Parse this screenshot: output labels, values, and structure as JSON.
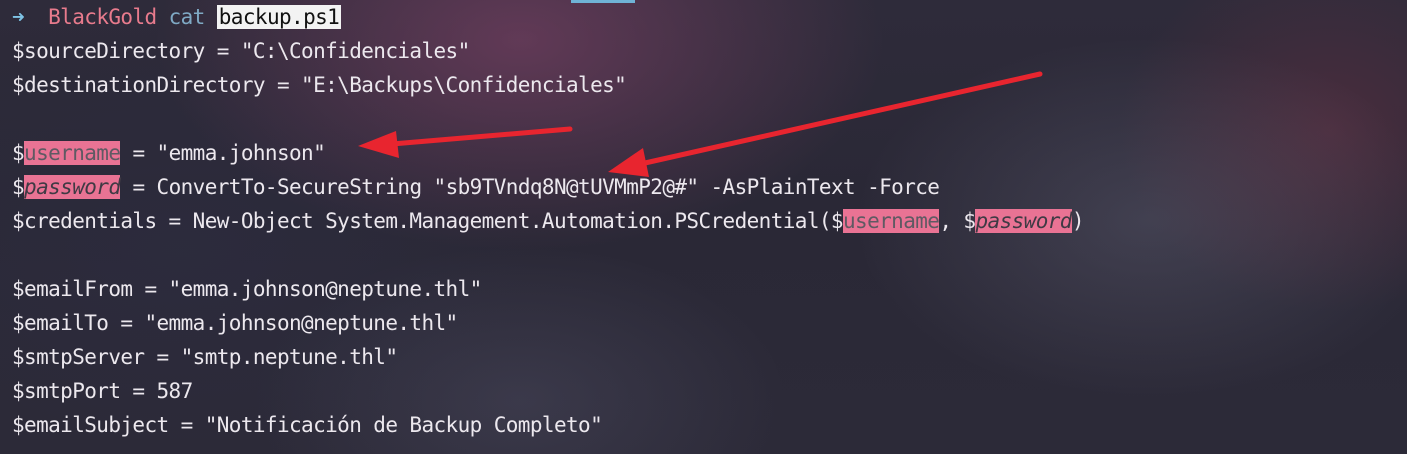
{
  "prompt": {
    "arrow": "➜",
    "host": "BlackGold",
    "command": "cat",
    "argument": "backup.ps1"
  },
  "code": {
    "line_source": "$sourceDirectory = \"C:\\Confidenciales\"",
    "line_destination": "$destinationDirectory = \"E:\\Backups\\Confidenciales\"",
    "username_dollar": "$",
    "username_var": "username",
    "username_rest": " = \"emma.johnson\"",
    "password_dollar": "$",
    "password_var": "password",
    "password_rest": " = ConvertTo-SecureString \"sb9TVndq8N@tUVMmP2@#\" -AsPlainText -Force",
    "cred_prefix": "$credentials = New-Object System.Management.Automation.PSCredential($",
    "cred_username": "username",
    "cred_sep": ", $",
    "cred_password": "password",
    "cred_suffix": ")",
    "line_email_from": "$emailFrom = \"emma.johnson@neptune.thl\"",
    "line_email_to": "$emailTo = \"emma.johnson@neptune.thl\"",
    "line_smtp_server": "$smtpServer = \"smtp.neptune.thl\"",
    "line_smtp_port": "$smtpPort = 587",
    "line_email_subject": "$emailSubject = \"Notificación de Backup Completo\""
  },
  "colors": {
    "annotation_arrow": "#e8252f",
    "highlight": "#e97394",
    "prompt_host": "#e87b8d",
    "prompt_arrow": "#7fc4e6"
  }
}
